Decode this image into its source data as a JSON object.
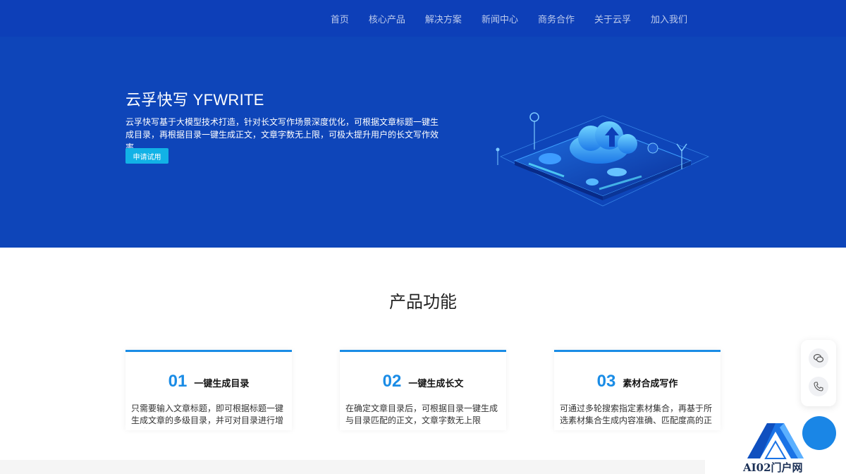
{
  "nav": {
    "items": [
      "首页",
      "核心产品",
      "解决方案",
      "新闻中心",
      "商务合作",
      "关于云孚",
      "加入我们"
    ]
  },
  "hero": {
    "title": "云孚快写 YFWRITE",
    "desc": "云孚快写基于大模型技术打造，针对长文写作场景深度优化，可根据文章标题一键生成目录，再根据目录一键生成正文，文章字数无上限，可极大提升用户的长文写作效率。",
    "button": "申请试用"
  },
  "features": {
    "title": "产品功能",
    "cards": [
      {
        "num": "01",
        "name": "一键生成目录",
        "text": "只需要输入文章标题，即可根据标题一键生成文章的多级目录，并可对目录进行增删改"
      },
      {
        "num": "02",
        "name": "一键生成长文",
        "text": "在确定文章目录后，可根据目录一键生成与目录匹配的正文，文章字数无上限"
      },
      {
        "num": "03",
        "name": "素材合成写作",
        "text": "可通过多轮搜索指定素材集合，再基于所选素材集合生成内容准确、匹配度高的正文"
      }
    ]
  },
  "watermark": {
    "text": "AI02门户网"
  },
  "colors": {
    "hero_bg": "#0e45b9",
    "accent": "#1a8ce6",
    "button": "#12b2e6"
  },
  "icons": [
    "chat-icon",
    "phone-icon",
    "cloud-upload-icon"
  ]
}
